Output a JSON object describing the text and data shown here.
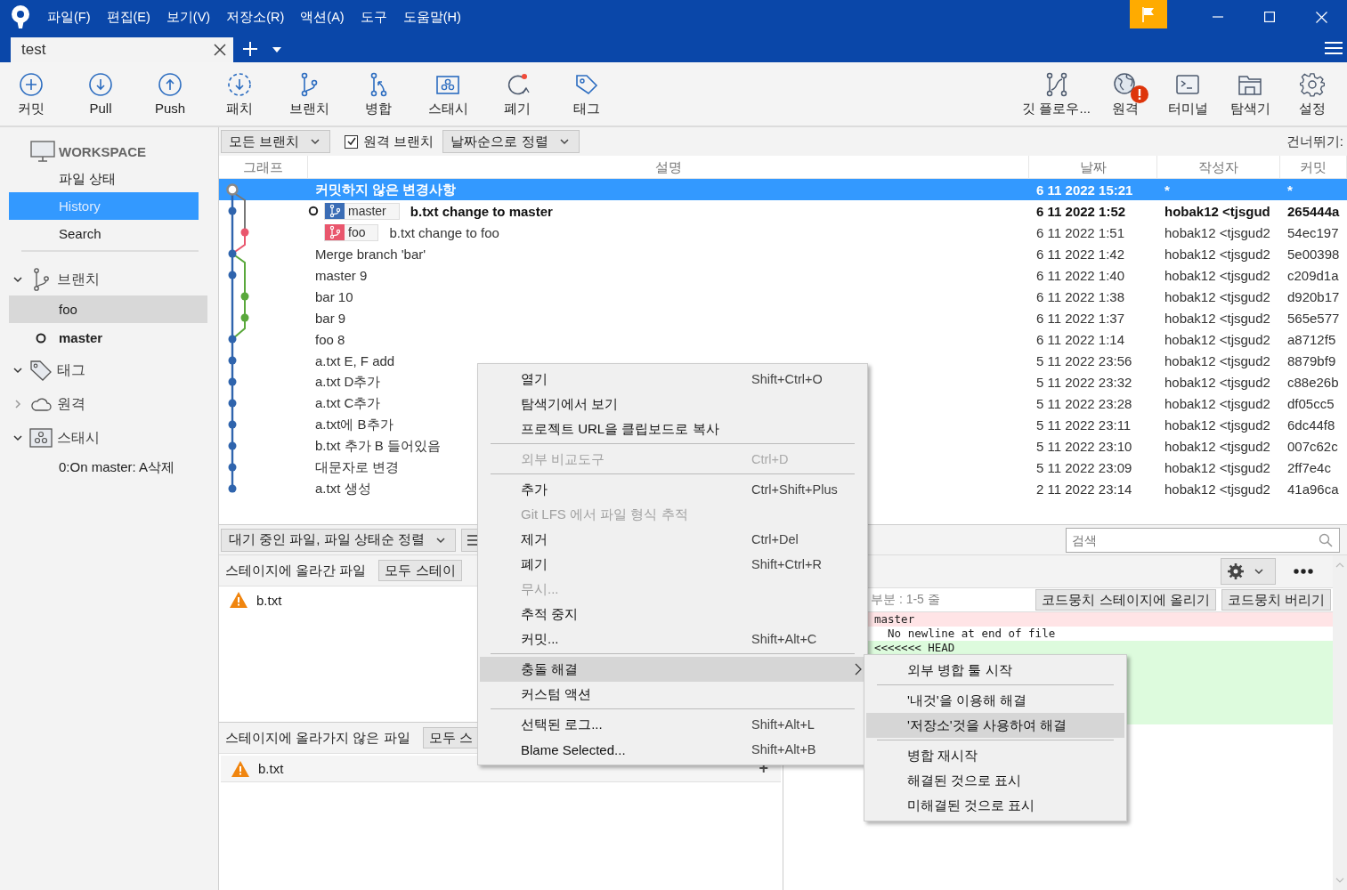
{
  "menu_bar": [
    "파일(F)",
    "편집(E)",
    "보기(V)",
    "저장소(R)",
    "액션(A)",
    "도구",
    "도움말(H)"
  ],
  "tabs": [
    {
      "label": "test",
      "selected": true
    }
  ],
  "toolbar": {
    "left": [
      {
        "kind": "commit",
        "label": "커밋"
      },
      {
        "kind": "pull",
        "label": "Pull"
      },
      {
        "kind": "push",
        "label": "Push"
      },
      {
        "kind": "fetch",
        "label": "패치"
      },
      {
        "kind": "branch",
        "label": "브랜치"
      },
      {
        "kind": "merge",
        "label": "병합"
      },
      {
        "kind": "stash",
        "label": "스태시"
      },
      {
        "kind": "discard",
        "label": "폐기"
      },
      {
        "kind": "tag",
        "label": "태그"
      }
    ],
    "right": [
      {
        "kind": "gitflow",
        "label": "깃 플로우...",
        "alert": false
      },
      {
        "kind": "remote",
        "label": "원격",
        "alert": true
      },
      {
        "kind": "terminal",
        "label": "터미널",
        "alert": false
      },
      {
        "kind": "explorer",
        "label": "탐색기",
        "alert": false
      },
      {
        "kind": "settings",
        "label": "설정",
        "alert": false
      }
    ]
  },
  "sidebar": {
    "workspace": {
      "title": "WORKSPACE",
      "items": [
        {
          "label": "파일 상태",
          "selected": false
        },
        {
          "label": "History",
          "selected": true
        },
        {
          "label": "Search",
          "selected": false
        }
      ]
    },
    "groups": [
      {
        "kind": "branches",
        "label": "브랜치",
        "expanded": true,
        "children": [
          {
            "label": "foo",
            "selected": true,
            "current": false
          },
          {
            "label": "master",
            "selected": false,
            "current": true
          }
        ]
      },
      {
        "kind": "tags",
        "label": "태그",
        "expanded": true
      },
      {
        "kind": "remotes",
        "label": "원격",
        "expanded": false
      },
      {
        "kind": "stashes",
        "label": "스태시",
        "expanded": true,
        "children": [
          {
            "label": "0:On master: A삭제",
            "selected": false,
            "current": false
          }
        ]
      }
    ]
  },
  "filter_bar": {
    "branches": "모든 브랜치",
    "remote_branches": {
      "label": "원격 브랜치",
      "checked": true
    },
    "sort": "날짜순으로 정렬",
    "jump_label": "건너뛰기:"
  },
  "commits": {
    "columns": [
      "그래프",
      "설명",
      "날짜",
      "작성자",
      "커밋"
    ],
    "rows": [
      {
        "kind": "uncommitted",
        "selected": true,
        "current": false,
        "description": "커밋하지 않은 변경사항",
        "date": "6 11 2022 15:21",
        "author": "*",
        "commit": "*"
      },
      {
        "kind": "commit",
        "selected": false,
        "current": true,
        "refs": [
          {
            "name": "master",
            "color": "#3b6db5",
            "current": true
          }
        ],
        "description": "b.txt change to master",
        "date": "6 11 2022 1:52",
        "author": "hobak12 <tjsgud",
        "commit": "265444a"
      },
      {
        "kind": "commit",
        "selected": false,
        "current": false,
        "refs": [
          {
            "name": "foo",
            "color": "#e9566d",
            "current": false
          }
        ],
        "description": "b.txt change to foo",
        "date": "6 11 2022 1:51",
        "author": "hobak12 <tjsgud2",
        "commit": "54ec197"
      },
      {
        "kind": "commit",
        "selected": false,
        "current": false,
        "description": "Merge branch 'bar'",
        "date": "6 11 2022 1:42",
        "author": "hobak12 <tjsgud2",
        "commit": "5e00398"
      },
      {
        "kind": "commit",
        "selected": false,
        "current": false,
        "description": "master 9",
        "date": "6 11 2022 1:40",
        "author": "hobak12 <tjsgud2",
        "commit": "c209d1a"
      },
      {
        "kind": "commit",
        "selected": false,
        "current": false,
        "description": "bar 10",
        "date": "6 11 2022 1:38",
        "author": "hobak12 <tjsgud2",
        "commit": "d920b17"
      },
      {
        "kind": "commit",
        "selected": false,
        "current": false,
        "description": "bar 9",
        "date": "6 11 2022 1:37",
        "author": "hobak12 <tjsgud2",
        "commit": "565e577"
      },
      {
        "kind": "commit",
        "selected": false,
        "current": false,
        "description": "foo 8",
        "date": "6 11 2022 1:14",
        "author": "hobak12 <tjsgud2",
        "commit": "a8712f5"
      },
      {
        "kind": "commit",
        "selected": false,
        "current": false,
        "description": "a.txt E, F add",
        "date": "5 11 2022 23:56",
        "author": "hobak12 <tjsgud2",
        "commit": "8879bf9"
      },
      {
        "kind": "commit",
        "selected": false,
        "current": false,
        "description": "a.txt D추가",
        "date": "5 11 2022 23:32",
        "author": "hobak12 <tjsgud2",
        "commit": "c88e26b"
      },
      {
        "kind": "commit",
        "selected": false,
        "current": false,
        "description": "a.txt C추가",
        "date": "5 11 2022 23:28",
        "author": "hobak12 <tjsgud2",
        "commit": "df05cc5"
      },
      {
        "kind": "commit",
        "selected": false,
        "current": false,
        "description": "a.txt에 B추가",
        "date": "5 11 2022 23:11",
        "author": "hobak12 <tjsgud2",
        "commit": "6dc44f8"
      },
      {
        "kind": "commit",
        "selected": false,
        "current": false,
        "description": "b.txt 추가 B 들어있음",
        "date": "5 11 2022 23:10",
        "author": "hobak12 <tjsgud2",
        "commit": "007c62c"
      },
      {
        "kind": "commit",
        "selected": false,
        "current": false,
        "description": "대문자로 변경",
        "date": "5 11 2022 23:09",
        "author": "hobak12 <tjsgud2",
        "commit": "2ff7e4c"
      },
      {
        "kind": "commit",
        "selected": false,
        "current": false,
        "description": "a.txt 생성",
        "date": "2 11 2022 23:14",
        "author": "hobak12 <tjsgud2",
        "commit": "41a96ca"
      }
    ]
  },
  "file_panel": {
    "sort": "대기 중인 파일, 파일 상태순 정렬",
    "staged": {
      "title": "스테이지에 올라간 파일",
      "button": "모두 스테이",
      "files": [
        {
          "name": "b.txt",
          "kind": "conflict"
        }
      ]
    },
    "unstaged": {
      "title": "스테이지에 올라가지 않은 파일",
      "button": "모두 스",
      "files": [
        {
          "name": "b.txt",
          "kind": "conflict",
          "action": "+"
        }
      ]
    }
  },
  "diff_panel": {
    "search_placeholder": "검색",
    "hunk_title": "부분 : 1-5 줄",
    "hunk_buttons": [
      "코드뭉치 스테이지에 올리기",
      "코드뭉치 버리기"
    ],
    "lines": [
      {
        "kind": "removed",
        "text": "master"
      },
      {
        "kind": "context",
        "text": "  No newline at end of file"
      },
      {
        "kind": "added",
        "text": "<<<<<<< HEAD"
      }
    ]
  },
  "context_menu": {
    "items": [
      {
        "kind": "item",
        "label": "열기",
        "shortcut": "Shift+Ctrl+O",
        "disabled": false,
        "highlighted": false
      },
      {
        "kind": "item",
        "label": "탐색기에서 보기",
        "disabled": false,
        "highlighted": false
      },
      {
        "kind": "item",
        "label": "프로젝트 URL을 클립보드로 복사",
        "disabled": false,
        "highlighted": false
      },
      {
        "kind": "separator"
      },
      {
        "kind": "item",
        "label": "외부 비교도구",
        "shortcut": "Ctrl+D",
        "disabled": true,
        "highlighted": false
      },
      {
        "kind": "separator"
      },
      {
        "kind": "item",
        "label": "추가",
        "shortcut": "Ctrl+Shift+Plus",
        "disabled": false,
        "highlighted": false
      },
      {
        "kind": "item",
        "label": "Git LFS 에서 파일 형식 추적",
        "disabled": true,
        "highlighted": false
      },
      {
        "kind": "item",
        "label": "제거",
        "shortcut": "Ctrl+Del",
        "disabled": false,
        "highlighted": false
      },
      {
        "kind": "item",
        "label": "폐기",
        "shortcut": "Shift+Ctrl+R",
        "disabled": false,
        "highlighted": false
      },
      {
        "kind": "item",
        "label": "무시...",
        "disabled": true,
        "highlighted": false
      },
      {
        "kind": "item",
        "label": "추적 중지",
        "disabled": false,
        "highlighted": false
      },
      {
        "kind": "item",
        "label": "커밋...",
        "shortcut": "Shift+Alt+C",
        "disabled": false,
        "highlighted": false
      },
      {
        "kind": "separator"
      },
      {
        "kind": "submenu",
        "label": "충돌 해결",
        "disabled": false,
        "highlighted": true
      },
      {
        "kind": "item",
        "label": "커스텀 액션",
        "disabled": false,
        "highlighted": false
      },
      {
        "kind": "separator"
      },
      {
        "kind": "item",
        "label": "선택된 로그...",
        "shortcut": "Shift+Alt+L",
        "disabled": false,
        "highlighted": false
      },
      {
        "kind": "item",
        "label": "Blame Selected...",
        "shortcut": "Shift+Alt+B",
        "disabled": false,
        "highlighted": false
      }
    ]
  },
  "submenu": {
    "items": [
      {
        "kind": "item",
        "label": "외부 병합 툴 시작",
        "disabled": false,
        "highlighted": false
      },
      {
        "kind": "separator"
      },
      {
        "kind": "item",
        "label": "'내것'을 이용해 해결",
        "disabled": false,
        "highlighted": false
      },
      {
        "kind": "item",
        "label": "'저장소'것을 사용하여 해결",
        "disabled": false,
        "highlighted": true
      },
      {
        "kind": "separator"
      },
      {
        "kind": "item",
        "label": "병합 재시작",
        "disabled": false,
        "highlighted": false
      },
      {
        "kind": "item",
        "label": "해결된 것으로 표시",
        "disabled": false,
        "highlighted": false
      },
      {
        "kind": "item",
        "label": "미해결된 것으로 표시",
        "disabled": false,
        "highlighted": false
      }
    ]
  }
}
